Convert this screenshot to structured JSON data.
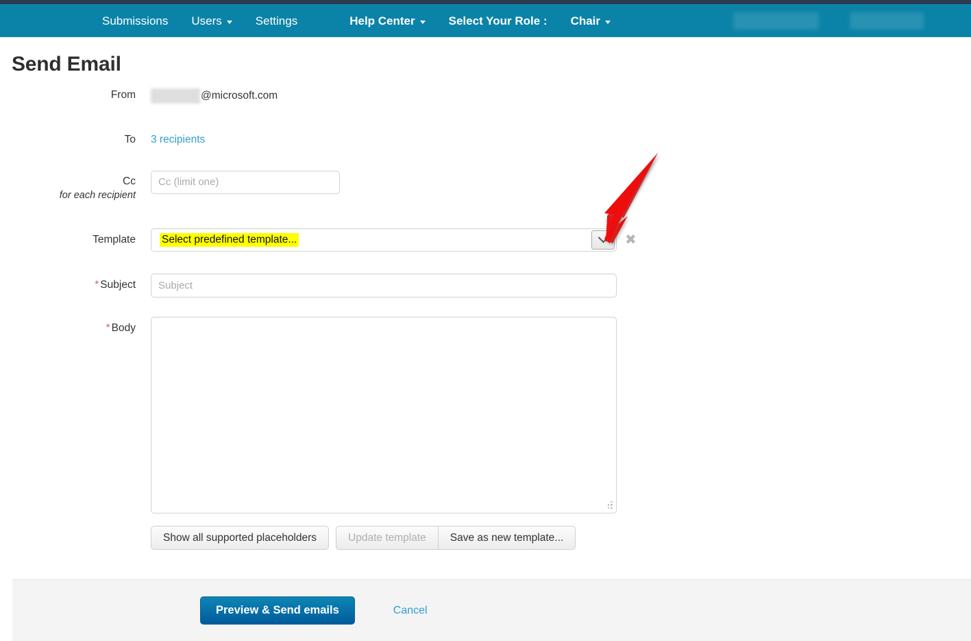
{
  "navbar": {
    "items": [
      {
        "label": "Submissions",
        "has_caret": false,
        "bold": false
      },
      {
        "label": "Users",
        "has_caret": true,
        "bold": false
      },
      {
        "label": "Settings",
        "has_caret": false,
        "bold": false
      },
      {
        "label": "Help Center",
        "has_caret": true,
        "bold": true
      },
      {
        "label": "Select Your Role :",
        "has_caret": false,
        "bold": true
      },
      {
        "label": "Chair",
        "has_caret": true,
        "bold": true
      }
    ],
    "background_color": "#0b83a8",
    "top_strip_color": "#2b3a4f",
    "redacted_items": 2
  },
  "page": {
    "title": "Send Email"
  },
  "form": {
    "from": {
      "label": "From",
      "value_suffix": "@microsoft.com",
      "redacted": true
    },
    "to": {
      "label": "To",
      "link_text": "3 recipients",
      "link_color": "#2f9fd0"
    },
    "cc": {
      "label": "Cc",
      "sublabel": "for each recipient",
      "placeholder": "Cc (limit one)",
      "value": ""
    },
    "template": {
      "label": "Template",
      "selected": "Select predefined template...",
      "highlight_color": "#ffff00",
      "dropdown_icon": "chevron-down-icon",
      "clear_icon": "close-x-icon"
    },
    "subject": {
      "label": "Subject",
      "required_marker": "*",
      "placeholder": "Subject",
      "value": ""
    },
    "body": {
      "label": "Body",
      "required_marker": "*",
      "value": ""
    },
    "template_buttons": {
      "show_placeholders": "Show all supported placeholders",
      "update_template": "Update template",
      "update_template_disabled": true,
      "save_as_new": "Save as new template..."
    }
  },
  "footer": {
    "primary_button": "Preview & Send emails",
    "primary_color": "#0d86b5",
    "cancel_link": "Cancel"
  },
  "annotation": {
    "arrow_color": "#ee1111",
    "points_to": "template-dropdown-button"
  }
}
